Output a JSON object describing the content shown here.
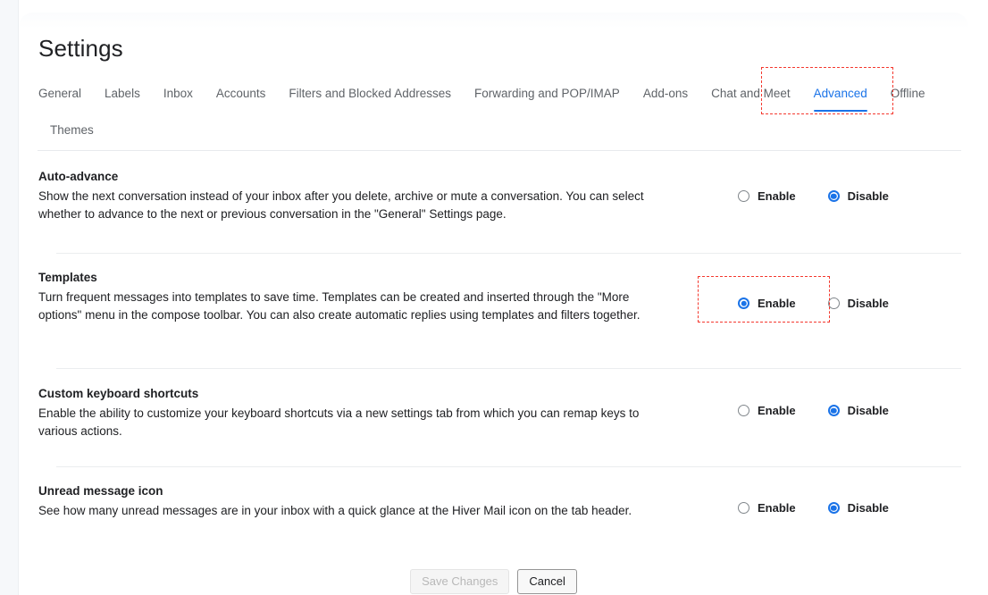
{
  "page": {
    "title": "Settings"
  },
  "tabs": [
    {
      "label": "General",
      "active": false
    },
    {
      "label": "Labels",
      "active": false
    },
    {
      "label": "Inbox",
      "active": false
    },
    {
      "label": "Accounts",
      "active": false
    },
    {
      "label": "Filters and Blocked Addresses",
      "active": false
    },
    {
      "label": "Forwarding and POP/IMAP",
      "active": false
    },
    {
      "label": "Add-ons",
      "active": false
    },
    {
      "label": "Chat and Meet",
      "active": false
    },
    {
      "label": "Advanced",
      "active": true
    },
    {
      "label": "Offline",
      "active": false
    },
    {
      "label": "Themes",
      "active": false
    }
  ],
  "settings": [
    {
      "key": "auto-advance",
      "title": "Auto-advance",
      "description": "Show the next conversation instead of your inbox after you delete, archive or mute a conversation. You can select whether to advance to the next or previous conversation in the \"General\" Settings page.",
      "options": [
        {
          "label": "Enable",
          "selected": false
        },
        {
          "label": "Disable",
          "selected": true
        }
      ]
    },
    {
      "key": "templates",
      "title": "Templates",
      "description": "Turn frequent messages into templates to save time. Templates can be created and inserted through the \"More options\" menu in the compose toolbar. You can also create automatic replies using templates and filters together.",
      "options": [
        {
          "label": "Enable",
          "selected": true
        },
        {
          "label": "Disable",
          "selected": false
        }
      ]
    },
    {
      "key": "custom-keyboard-shortcuts",
      "title": "Custom keyboard shortcuts",
      "description": "Enable the ability to customize your keyboard shortcuts via a new settings tab from which you can remap keys to various actions.",
      "options": [
        {
          "label": "Enable",
          "selected": false
        },
        {
          "label": "Disable",
          "selected": true
        }
      ]
    },
    {
      "key": "unread-message-icon",
      "title": "Unread message icon",
      "description": "See how many unread messages are in your inbox with a quick glance at the Hiver Mail icon on the tab header.",
      "options": [
        {
          "label": "Enable",
          "selected": false
        },
        {
          "label": "Disable",
          "selected": true
        }
      ]
    }
  ],
  "footer": {
    "save_label": "Save Changes",
    "save_disabled": true,
    "cancel_label": "Cancel"
  },
  "annotations": [
    {
      "name": "advanced-tab-highlight",
      "color": "#f4392f"
    },
    {
      "name": "templates-enable-highlight",
      "color": "#f4392f"
    }
  ],
  "colors": {
    "accent": "#1a73e8",
    "annotation": "#f4392f",
    "text": "#202124",
    "muted": "#5f6368",
    "divider": "#e8eaed"
  }
}
